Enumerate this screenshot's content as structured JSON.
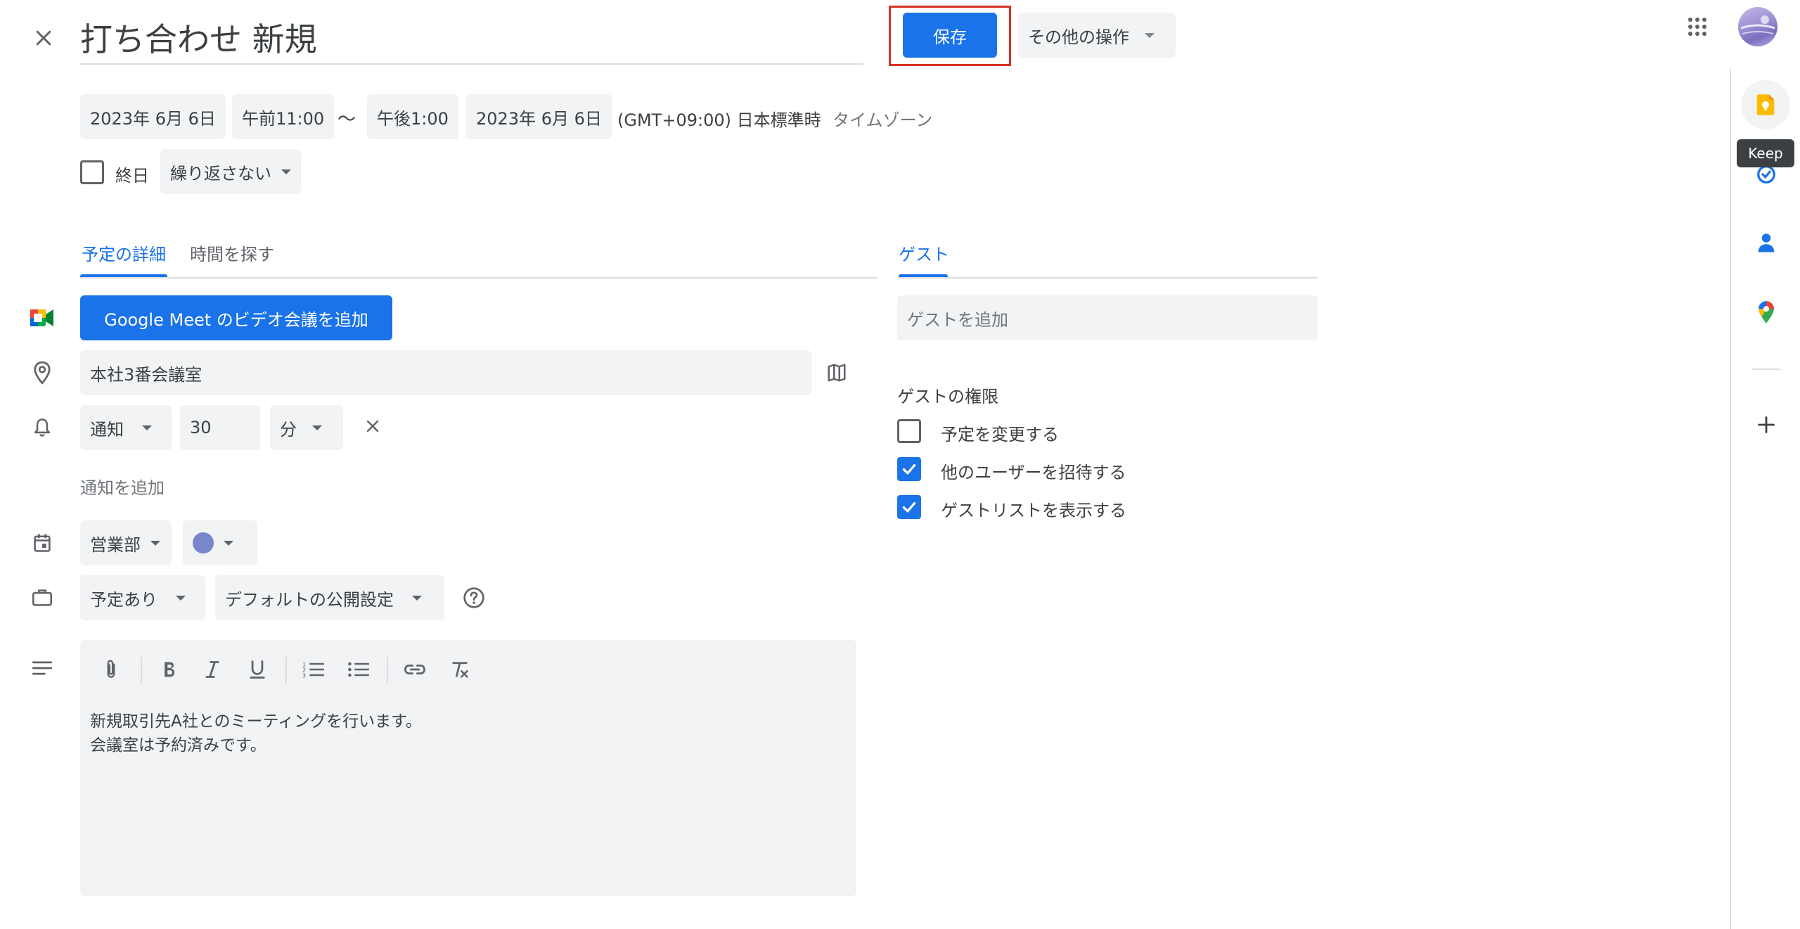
{
  "header": {
    "title": "打ち合わせ 新規",
    "save_label": "保存",
    "more_actions_label": "その他の操作"
  },
  "datetime": {
    "start_date": "2023年 6月 6日",
    "start_time": "午前11:00",
    "separator": "〜",
    "end_time": "午後1:00",
    "end_date": "2023年 6月 6日",
    "timezone_value": "(GMT+09:00) 日本標準時",
    "timezone_link": "タイムゾーン",
    "all_day_label": "終日",
    "repeat_label": "繰り返さない"
  },
  "tabs": {
    "details": "予定の詳細",
    "find_time": "時間を探す",
    "guests": "ゲスト"
  },
  "details": {
    "meet_button": "Google Meet のビデオ会議を追加",
    "location_value": "本社3番会議室",
    "notification_type": "通知",
    "notification_value": "30",
    "notification_unit": "分",
    "add_notification": "通知を追加",
    "calendar_name": "営業部",
    "availability": "予定あり",
    "visibility": "デフォルトの公開設定",
    "description_line1": "新規取引先A社とのミーティングを行います。",
    "description_line2": "会議室は予約済みです。"
  },
  "guests": {
    "add_placeholder": "ゲストを追加",
    "permissions_title": "ゲストの権限",
    "perm_modify": "予定を変更する",
    "perm_invite": "他のユーザーを招待する",
    "perm_see_list": "ゲストリストを表示する",
    "perm_modify_checked": false,
    "perm_invite_checked": true,
    "perm_see_list_checked": true
  },
  "side_panel": {
    "tooltip": "Keep"
  },
  "colors": {
    "accent": "#1a73e8",
    "save_highlight_border": "#d93025",
    "event_color": "#7986cb",
    "keep_yellow": "#fbbc04",
    "chip_bg": "#f1f3f4"
  }
}
